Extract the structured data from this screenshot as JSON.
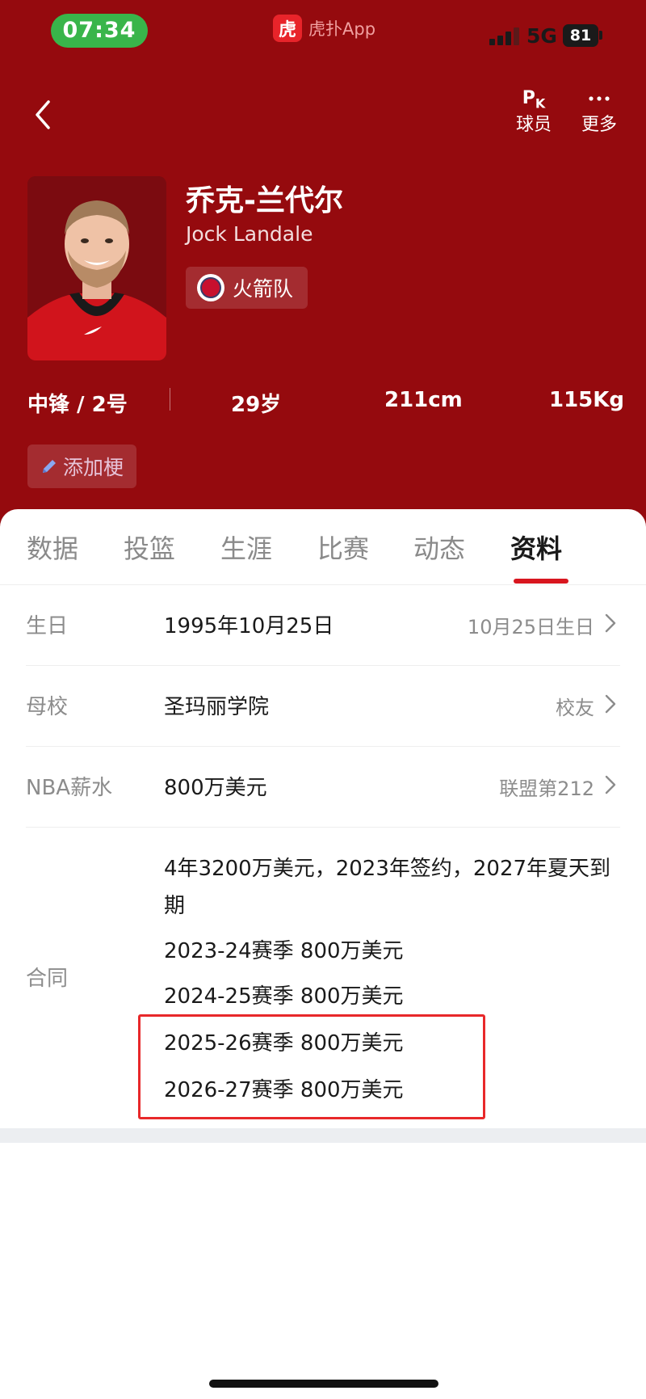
{
  "status_bar": {
    "time": "07:34",
    "app_logo_char": "虎",
    "app_name": "虎扑App",
    "network": "5G",
    "battery": "81"
  },
  "nav": {
    "back_icon": "chevron-left-icon",
    "pk_letters": "PK",
    "pk_label": "球员",
    "more_label": "更多"
  },
  "player": {
    "name_cn": "乔克-兰代尔",
    "name_en": "Jock Landale",
    "team": "火箭队",
    "position": "中锋 / 2号",
    "age": "29岁",
    "height": "211cm",
    "weight": "115Kg",
    "add_tag_label": "添加梗"
  },
  "tabs": [
    {
      "label": "数据",
      "active": false
    },
    {
      "label": "投篮",
      "active": false
    },
    {
      "label": "生涯",
      "active": false
    },
    {
      "label": "比赛",
      "active": false
    },
    {
      "label": "动态",
      "active": false
    },
    {
      "label": "资料",
      "active": true
    }
  ],
  "info": {
    "birthday": {
      "label": "生日",
      "value": "1995年10月25日",
      "right": "10月25日生日"
    },
    "school": {
      "label": "母校",
      "value": "圣玛丽学院",
      "right": "校友"
    },
    "salary": {
      "label": "NBA薪水",
      "value": "800万美元",
      "right": "联盟第212"
    },
    "contract": {
      "label": "合同",
      "summary_line1": "4年3200万美元，2023年签约，2027年夏天到",
      "summary_line2": "期",
      "seasons": [
        "2023-24赛季 800万美元",
        "2024-25赛季 800万美元",
        "2025-26赛季 800万美元",
        "2026-27赛季 800万美元"
      ]
    }
  },
  "colors": {
    "header_bg": "#950a0e",
    "accent": "#d8161f",
    "time_pill": "#39b54a",
    "highlight": "#e8282a"
  }
}
